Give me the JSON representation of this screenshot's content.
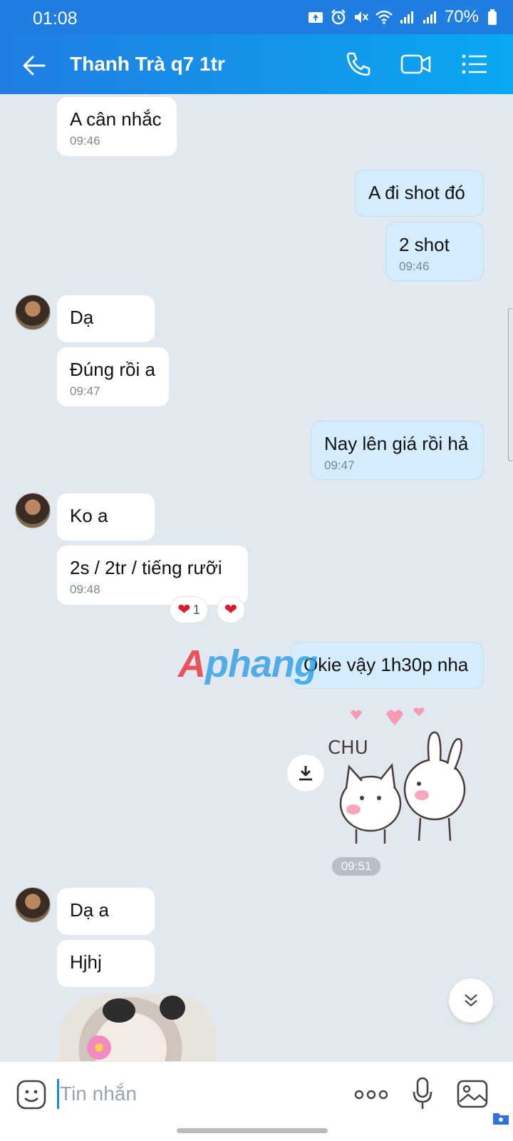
{
  "status_bar": {
    "time": "01:08",
    "battery": "70%",
    "icons": [
      "upload-icon",
      "alarm-icon",
      "mute-icon",
      "wifi-icon",
      "signal-icon",
      "signal-icon",
      "battery-icon"
    ]
  },
  "header": {
    "title": "Thanh Trà q7 1tr",
    "icons": [
      "back-arrow-icon",
      "phone-icon",
      "video-call-icon",
      "menu-list-icon"
    ]
  },
  "messages": [
    {
      "dir": "in",
      "text": "A cân nhắc",
      "time": "09:46"
    },
    {
      "dir": "out",
      "text": "A đi shot đó",
      "time": ""
    },
    {
      "dir": "out",
      "text": "2 shot",
      "time": "09:46"
    },
    {
      "dir": "in",
      "text": "Dạ",
      "time": ""
    },
    {
      "dir": "in",
      "text": "Đúng rồi a",
      "time": "09:47"
    },
    {
      "dir": "out",
      "text": "Nay lên giá rồi hả",
      "time": "09:47"
    },
    {
      "dir": "in",
      "text": "Ko a",
      "time": ""
    },
    {
      "dir": "in",
      "text": "2s / 2tr / tiếng rưỡi",
      "time": "09:48"
    },
    {
      "dir": "out",
      "text": "Okie vậy 1h30p nha",
      "time": ""
    },
    {
      "dir": "in",
      "text": "Dạ a",
      "time": ""
    },
    {
      "dir": "in",
      "text": "Hjhj",
      "time": ""
    }
  ],
  "reaction": {
    "count": "1",
    "icon": "heart-icon"
  },
  "sticker": {
    "caption": "CHU",
    "time": "09:51"
  },
  "watermark": {
    "prefix": "A",
    "rest": "phang"
  },
  "input": {
    "placeholder": "Tin nhắn"
  },
  "colors": {
    "header_start": "#1f7ee0",
    "header_end": "#0aa8f2",
    "out_bubble": "#d4ecfb",
    "in_bubble": "#ffffff",
    "chat_bg": "#e2e8ef",
    "heart": "#e0182b"
  }
}
